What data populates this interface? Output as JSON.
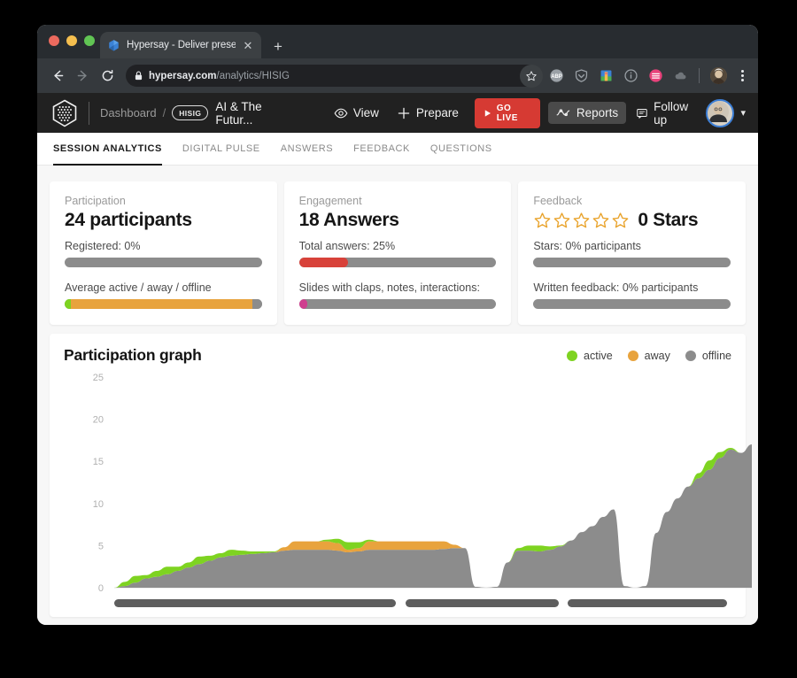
{
  "browser": {
    "tab": {
      "title": "Hypersay - Deliver presentatio",
      "favicon": "hypersay-favicon",
      "close_icon": "close-icon"
    },
    "newtab_icon": "plus-icon",
    "back_icon": "back-arrow-icon",
    "forward_icon": "forward-arrow-icon",
    "reload_icon": "reload-icon",
    "lock_icon": "lock-icon",
    "url_domain": "hypersay.com",
    "url_path": "/analytics/HISIG",
    "star_icon": "star-outline-icon",
    "extensions": [
      "abp-adblock-icon",
      "shield-icon",
      "bookmark-manager-icon",
      "info-circle-icon",
      "todoist-icon",
      "cloud-icon"
    ],
    "profile_icon": "profile-avatar-icon",
    "menu_icon": "kebab-menu-icon"
  },
  "appnav": {
    "logo": "hypersay-logo-icon",
    "breadcrumb_root": "Dashboard",
    "breadcrumb_separator": "/",
    "session_code": "HISIG",
    "deck_title": "AI & The Futur...",
    "actions": [
      {
        "label": "View",
        "icon": "eye-icon",
        "style": "plain"
      },
      {
        "label": "Prepare",
        "icon": "plus-icon",
        "style": "plain"
      }
    ],
    "go_live": {
      "label": "GO LIVE",
      "icon": "play-icon",
      "color": "#d63a33"
    },
    "actions_right": [
      {
        "label": "Reports",
        "icon": "analytics-wave-icon",
        "style": "filled"
      },
      {
        "label": "Follow up",
        "icon": "message-icon",
        "style": "plain"
      }
    ],
    "avatar": "user-avatar",
    "chevron": "chevron-down-icon"
  },
  "section_tabs": [
    {
      "label": "SESSION ANALYTICS",
      "active": true
    },
    {
      "label": "DIGITAL PULSE",
      "active": false
    },
    {
      "label": "ANSWERS",
      "active": false
    },
    {
      "label": "FEEDBACK",
      "active": false
    },
    {
      "label": "QUESTIONS",
      "active": false
    }
  ],
  "cards": {
    "participation": {
      "label": "Participation",
      "value": "24 participants",
      "metric1_text": "Registered: 0%",
      "metric1_fill_pct": 0,
      "metric2_text": "Average active / away / offline",
      "metric2_active_pct": 3,
      "metric2_away_pct": 92,
      "metric2_offline_pct": 5
    },
    "engagement": {
      "label": "Engagement",
      "value": "18 Answers",
      "metric1_text": "Total answers: 25%",
      "metric1_fill_pct": 25,
      "metric1_color": "#d8423a",
      "metric2_text": "Slides with claps, notes, interactions:",
      "metric2_fill_pct": 4,
      "metric2_color": "#cf3f8f"
    },
    "feedback": {
      "label": "Feedback",
      "stars_count": 5,
      "stars_filled": 0,
      "value": "0 Stars",
      "metric1_text": "Stars: 0% participants",
      "metric1_fill_pct": 0,
      "metric2_text": "Written feedback: 0% participants",
      "metric2_fill_pct": 0
    }
  },
  "graph": {
    "title": "Participation graph",
    "legend": [
      {
        "label": "active",
        "color": "#7ed321"
      },
      {
        "label": "away",
        "color": "#e8a33d"
      },
      {
        "label": "offline",
        "color": "#8c8c8c"
      }
    ]
  },
  "chart_data": {
    "type": "area",
    "title": "Participation graph",
    "xlabel": "",
    "ylabel": "",
    "ylim": [
      0,
      25
    ],
    "yticks": [
      0,
      5,
      10,
      15,
      20,
      25
    ],
    "grid": false,
    "legend_position": "top-right",
    "stacked": true,
    "colors": {
      "offline": "#8c8c8c",
      "away": "#e8a33d",
      "active": "#7ed321"
    },
    "x": [
      0,
      1,
      2,
      3,
      4,
      5,
      6,
      7,
      8,
      9,
      10,
      11,
      12,
      13,
      14,
      15,
      16,
      17,
      18,
      19,
      20,
      21,
      22,
      23,
      24,
      25,
      26,
      27,
      28,
      29,
      30,
      31,
      32,
      33,
      34,
      35,
      36,
      37,
      38,
      39,
      40,
      41,
      42,
      43,
      44,
      45,
      46,
      47,
      48,
      49,
      50,
      51,
      52,
      53,
      54,
      55,
      56,
      57,
      58,
      59,
      60
    ],
    "series": [
      {
        "name": "offline",
        "values": [
          0,
          0.2,
          0.6,
          1.1,
          1.3,
          1.6,
          2.0,
          2.4,
          2.8,
          3.2,
          3.6,
          3.8,
          3.9,
          4.0,
          4.1,
          4.2,
          4.4,
          4.5,
          4.5,
          4.5,
          4.5,
          4.4,
          4.2,
          4.3,
          4.5,
          4.5,
          4.5,
          4.5,
          4.5,
          4.5,
          4.5,
          4.6,
          4.7,
          4.7,
          0.1,
          0,
          0.1,
          3.0,
          4.4,
          4.4,
          4.3,
          4.5,
          4.9,
          5.6,
          6.6,
          7.3,
          8.4,
          9.3,
          0.2,
          0,
          0.2,
          6.5,
          9.0,
          10.6,
          12.0,
          13.0,
          14.0,
          15.4,
          16.4,
          16.0,
          17.0
        ]
      },
      {
        "name": "away",
        "values": [
          0,
          0,
          0,
          0,
          0,
          0,
          0,
          0,
          0,
          0,
          0,
          0,
          0,
          0,
          0,
          0,
          0.4,
          1.0,
          1.0,
          1.0,
          1.0,
          0.9,
          0.3,
          0.4,
          1.0,
          1.0,
          1.0,
          1.0,
          1.0,
          1.0,
          1.0,
          0.9,
          0.4,
          0,
          0,
          0,
          0,
          0,
          0,
          0,
          0,
          0,
          0,
          0,
          0,
          0,
          0,
          0,
          0,
          0,
          0,
          0,
          0,
          0,
          0,
          0,
          0,
          0,
          0,
          0,
          0
        ]
      },
      {
        "name": "active",
        "values": [
          0,
          0.5,
          0.8,
          0.4,
          0.7,
          0.9,
          0.5,
          0.6,
          0.9,
          0.6,
          0.5,
          0.7,
          0.5,
          0.3,
          0.2,
          0.1,
          0,
          0,
          0,
          0,
          0.2,
          0.5,
          0.9,
          0.7,
          0.2,
          0,
          0,
          0,
          0,
          0,
          0,
          0,
          0,
          0,
          0,
          0,
          0,
          0,
          0.3,
          0.6,
          0.7,
          0.4,
          0.1,
          0,
          0,
          0,
          0,
          0,
          0,
          0,
          0,
          0,
          0,
          0,
          0,
          0.6,
          1.1,
          0.7,
          0.2,
          0,
          0
        ]
      }
    ],
    "segments": [
      {
        "start_pct": 0,
        "width_pct": 46
      },
      {
        "start_pct": 47.5,
        "width_pct": 25
      },
      {
        "start_pct": 74,
        "width_pct": 26
      }
    ]
  }
}
